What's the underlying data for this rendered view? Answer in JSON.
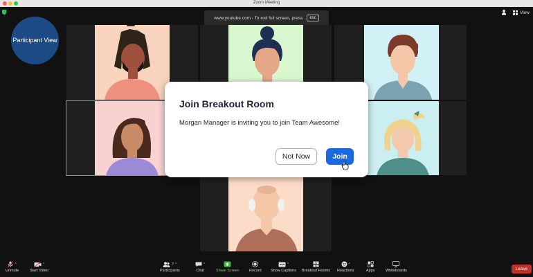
{
  "window": {
    "title": "Zoom Meeting"
  },
  "fullscreen_banner": {
    "text": "www.youtube.com - To exit full screen, press",
    "key": "esc"
  },
  "top_right": {
    "view_label": "View"
  },
  "participant_view": {
    "label": "Participant View"
  },
  "modal": {
    "title": "Join Breakout Room",
    "message": "Morgan Manager is inviting you to join Team Awesome!",
    "not_now_label": "Not Now",
    "join_label": "Join"
  },
  "toolbar": {
    "unmute": "Unmute",
    "start_video": "Start Video",
    "participants": "Participants",
    "participants_count": "7",
    "chat": "Chat",
    "share_screen": "Share Screen",
    "record": "Record",
    "show_captions": "Show Captions",
    "breakout_rooms": "Breakout Rooms",
    "reactions": "Reactions",
    "apps": "Apps",
    "whiteboards": "Whiteboards",
    "leave": "Leave"
  },
  "colors": {
    "join_button": "#1a69e0",
    "leave_button": "#c0302b",
    "share_screen": "#6dd36a",
    "active_speaker_border": "#5bbf4a",
    "participant_view_bubble": "#1c4a85"
  }
}
